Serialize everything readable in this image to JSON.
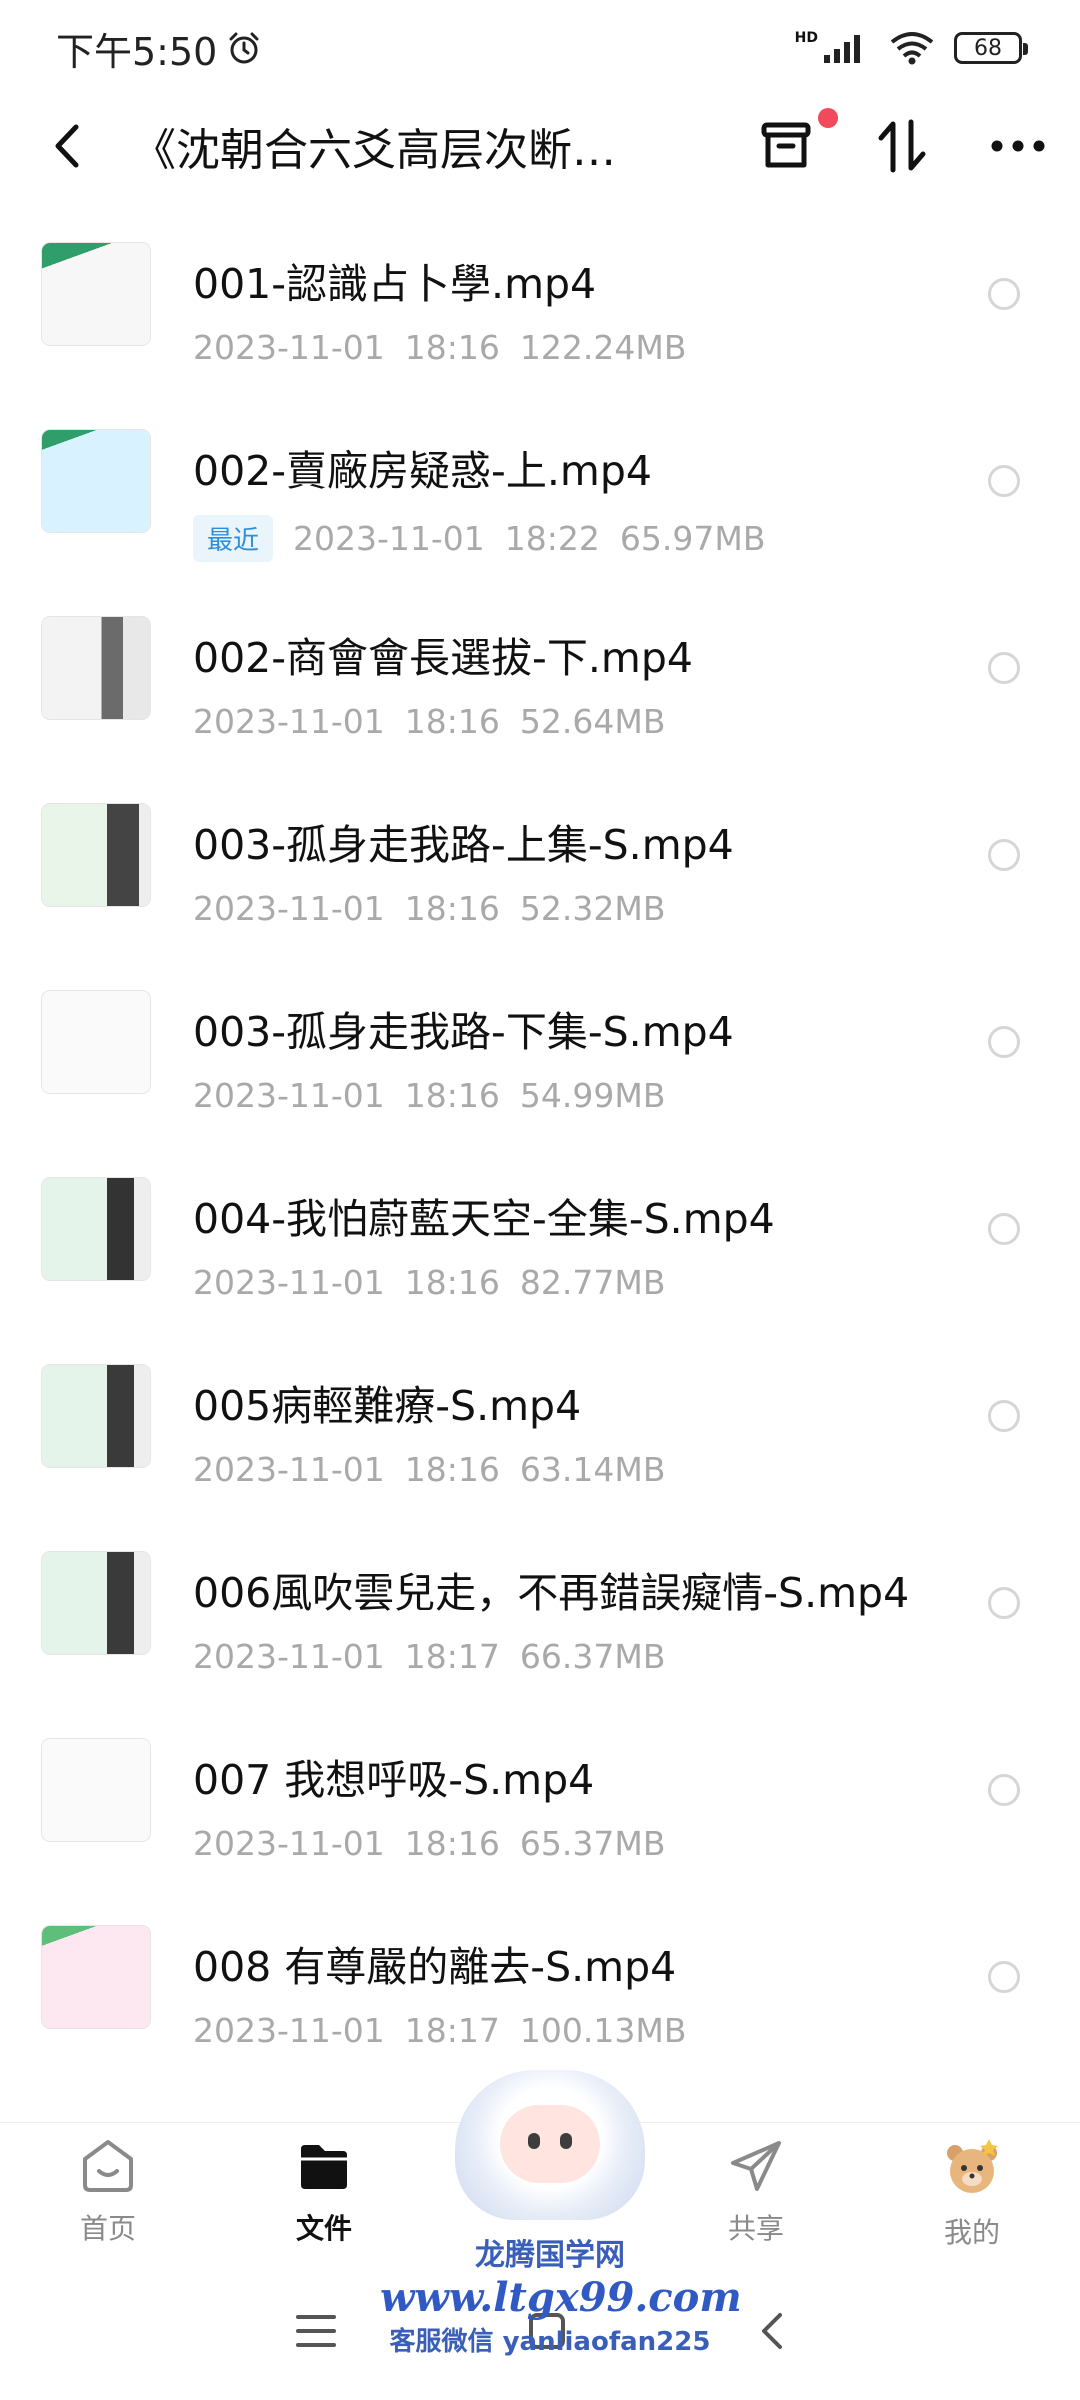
{
  "status": {
    "time": "下午5:50",
    "battery": "68",
    "network": "HD"
  },
  "header": {
    "title": "《沈朝合六爻高层次断…"
  },
  "files": [
    {
      "name": "001-認識占卜學.mp4",
      "date": "2023-11-01",
      "time": "18:16",
      "size": "122.24MB",
      "badge": ""
    },
    {
      "name": "002-賣廠房疑惑-上.mp4",
      "date": "2023-11-01",
      "time": "18:22",
      "size": "65.97MB",
      "badge": "最近"
    },
    {
      "name": "002-商會會長選拔-下.mp4",
      "date": "2023-11-01",
      "time": "18:16",
      "size": "52.64MB",
      "badge": ""
    },
    {
      "name": "003-孤身走我路-上集-S.mp4",
      "date": "2023-11-01",
      "time": "18:16",
      "size": "52.32MB",
      "badge": ""
    },
    {
      "name": "003-孤身走我路-下集-S.mp4",
      "date": "2023-11-01",
      "time": "18:16",
      "size": "54.99MB",
      "badge": ""
    },
    {
      "name": "004-我怕蔚藍天空-全集-S.mp4",
      "date": "2023-11-01",
      "time": "18:16",
      "size": "82.77MB",
      "badge": ""
    },
    {
      "name": "005病輕難療-S.mp4",
      "date": "2023-11-01",
      "time": "18:16",
      "size": "63.14MB",
      "badge": ""
    },
    {
      "name": "006風吹雲兒走，不再錯誤癡情-S.mp4",
      "date": "2023-11-01",
      "time": "18:17",
      "size": "66.37MB",
      "badge": ""
    },
    {
      "name": "007 我想呼吸-S.mp4",
      "date": "2023-11-01",
      "time": "18:16",
      "size": "65.37MB",
      "badge": ""
    },
    {
      "name": "008 有尊嚴的離去-S.mp4",
      "date": "2023-11-01",
      "time": "18:17",
      "size": "100.13MB",
      "badge": ""
    }
  ],
  "nav": [
    {
      "label": "首页",
      "icon": "home-icon"
    },
    {
      "label": "文件",
      "icon": "folder-icon",
      "active": true
    },
    {
      "label": "共享",
      "icon": "share-icon"
    },
    {
      "label": "我的",
      "icon": "profile-icon"
    }
  ],
  "watermark": {
    "line1": "龙腾国学网",
    "line2": "www.ltgx99.com",
    "line3": "客服微信 yanliaofan225"
  },
  "colors": {
    "accent": "#2e8fd8",
    "badge_bg": "#eaf4fb",
    "notification_dot": "#f04a5c",
    "meta_text": "#a9a9a9"
  }
}
